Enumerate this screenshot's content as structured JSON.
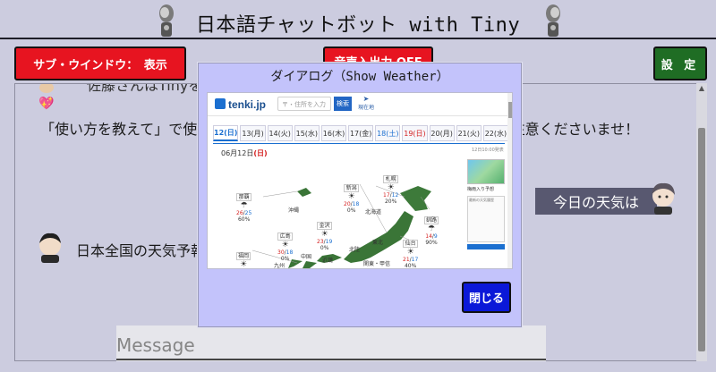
{
  "app": {
    "title": "日本語チャットボット with Tiny"
  },
  "toolbar": {
    "sub_window_label": "サブ・ウインドウ：　表示",
    "voice_io_label": "音声入出力 OFF",
    "settings_label": "設 定"
  },
  "chat": {
    "top_partial_text": "佐藤さんはTinyを使用...                                                 ...ただけます。",
    "body_text": "「使い方を教えて」で使い方を表示します。なお、個人情報の入力にはご注意くださいませ！",
    "user_message_partial": "日本全国の天気予報",
    "assistant_bubble": "今日の天気は"
  },
  "input": {
    "placeholder": "Message"
  },
  "dialog": {
    "title": "ダイアログ（Show Weather）",
    "close_label": "閉じる",
    "webview": {
      "logo_text": "tenki.jp",
      "search_placeholder": "〒・住所を入力",
      "search_button": "検索",
      "location_button": "現在地",
      "dates": [
        {
          "label": "12(日)",
          "kind": "active"
        },
        {
          "label": "13(月)",
          "kind": ""
        },
        {
          "label": "14(火)",
          "kind": ""
        },
        {
          "label": "15(水)",
          "kind": ""
        },
        {
          "label": "16(木)",
          "kind": ""
        },
        {
          "label": "17(金)",
          "kind": ""
        },
        {
          "label": "18(土)",
          "kind": "sat"
        },
        {
          "label": "19(日)",
          "kind": "sun"
        },
        {
          "label": "20(月)",
          "kind": ""
        },
        {
          "label": "21(火)",
          "kind": ""
        },
        {
          "label": "22(水)",
          "kind": ""
        }
      ],
      "date_heading_prefix": "06月12日",
      "date_heading_day": "(日)",
      "as_of": "12日10:00発表",
      "side_label": "梅雨入り予想",
      "side_box_label": "最新の天気履歴",
      "cities": [
        {
          "name": "那覇",
          "hi": "26",
          "lo": "25",
          "pop": "60%",
          "icon": "☂"
        },
        {
          "name": "沖縄",
          "hi": "",
          "lo": "",
          "pop": "",
          "icon": ""
        },
        {
          "name": "新潟",
          "hi": "20",
          "lo": "18",
          "pop": "0%",
          "icon": "☀"
        },
        {
          "name": "札幌",
          "hi": "17",
          "lo": "12",
          "pop": "20%",
          "icon": "☀"
        },
        {
          "name": "金沢",
          "hi": "23",
          "lo": "19",
          "pop": "0%",
          "icon": "☀"
        },
        {
          "name": "広島",
          "hi": "30",
          "lo": "18",
          "pop": "0%",
          "icon": "☀"
        },
        {
          "name": "釧路",
          "hi": "14",
          "lo": "9",
          "pop": "90%",
          "icon": "☂"
        },
        {
          "name": "仙台",
          "hi": "21",
          "lo": "17",
          "pop": "40%",
          "icon": "☀"
        },
        {
          "name": "福岡",
          "hi": "",
          "lo": "",
          "pop": "",
          "icon": "☀"
        }
      ],
      "region_labels": [
        "北海道",
        "中国",
        "近畿",
        "北陸",
        "東北",
        "関東・甲信",
        "九州"
      ]
    }
  }
}
